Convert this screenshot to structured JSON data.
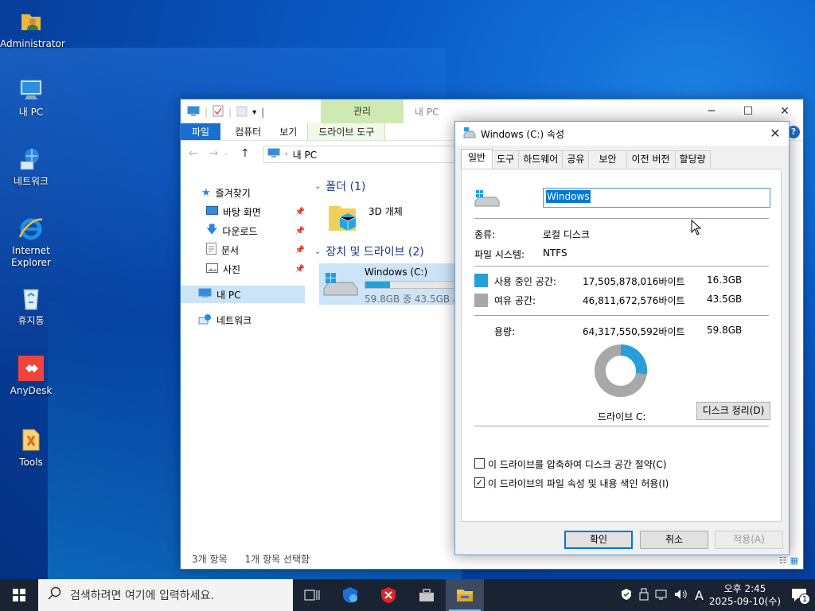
{
  "desktop": {
    "icons": [
      {
        "label": "Administrator",
        "icon": "user-folder-icon"
      },
      {
        "label": "내 PC",
        "icon": "computer-icon"
      },
      {
        "label": "네트워크",
        "icon": "network-icon"
      },
      {
        "label": "Internet Explorer",
        "icon": "internet-explorer-icon"
      },
      {
        "label": "휴지통",
        "icon": "recycle-bin-icon"
      },
      {
        "label": "AnyDesk",
        "icon": "anydesk-icon"
      },
      {
        "label": "Tools",
        "icon": "tools-folder-icon"
      }
    ]
  },
  "explorer": {
    "title": "내 PC",
    "context_tab": "관리",
    "tabs": [
      "파일",
      "컴퓨터",
      "보기",
      "드라이브 도구"
    ],
    "address": "내 PC",
    "nav": {
      "quick_access": "즐겨찾기",
      "items": [
        "바탕 화면",
        "다운로드",
        "문서",
        "사진"
      ],
      "this_pc": "내 PC",
      "network": "네트워크"
    },
    "groups": {
      "folders": {
        "label": "폴더 (1)",
        "items": [
          "3D 개체"
        ]
      },
      "drives": {
        "label": "장치 및 드라이브 (2)",
        "drive_name": "Windows (C:)",
        "drive_space": "59.8GB 중 43.5GB 사",
        "used_fraction": 0.27
      }
    },
    "status": {
      "count": "3개 항목",
      "selected": "1개 항목 선택함"
    }
  },
  "dialog": {
    "title": "Windows (C:) 속성",
    "tabs": [
      "일반",
      "도구",
      "하드웨어",
      "공유",
      "보안",
      "이전 버전",
      "할당량"
    ],
    "name_value": "Windows",
    "type_label": "종류:",
    "type_value": "로컬 디스크",
    "fs_label": "파일 시스템:",
    "fs_value": "NTFS",
    "used_label": "사용 중인 공간:",
    "used_bytes": "17,505,878,016바이트",
    "used_gb": "16.3GB",
    "free_label": "여유 공간:",
    "free_bytes": "46,811,672,576바이트",
    "free_gb": "43.5GB",
    "capacity_label": "용량:",
    "capacity_bytes": "64,317,550,592바이트",
    "capacity_gb": "59.8GB",
    "drive_label": "드라이브 C:",
    "cleanup_button": "디스크 정리(D)",
    "compress_label": "이 드라이브를 압축하여 디스크 공간 절약(C)",
    "compress_checked": false,
    "index_label": "이 드라이브의 파일 속성 및 내용 색인 허용(I)",
    "index_checked": true,
    "ok_button": "확인",
    "cancel_button": "취소",
    "apply_button": "적용(A)",
    "used_fraction": 0.272,
    "colors": {
      "used": "#26a0da",
      "free": "#a8a8a8"
    }
  },
  "taskbar": {
    "search_placeholder": "검색하려면 여기에 입력하세요.",
    "ime_indicator": "A",
    "time": "오후 2:45",
    "date": "2025-09-10(수)",
    "notification_count": "1"
  }
}
